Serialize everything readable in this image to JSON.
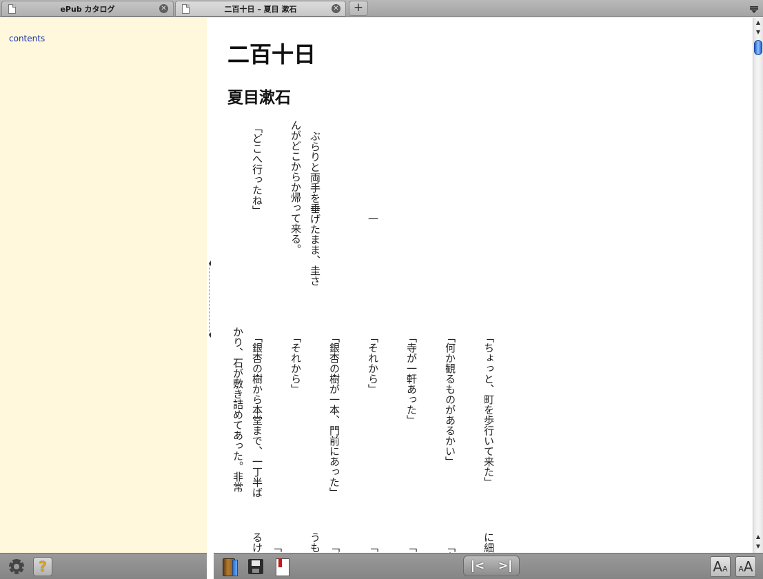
{
  "tabs": [
    {
      "label": "ePub カタログ",
      "active": false
    },
    {
      "label": "二百十日 – 夏目 漱石",
      "active": true
    }
  ],
  "tabbar": {
    "new_tab_label": "+"
  },
  "sidebar": {
    "contents_link": "contents"
  },
  "book": {
    "title": "二百十日",
    "author": "夏目漱石",
    "sections": [
      {
        "columns": [
          "一",
          "ぶらりと両手を垂げたまま、圭さ",
          "んがどこからか帰って来る。",
          "「どこへ行ったね」"
        ]
      },
      {
        "columns": [
          "「ちょっと、町を歩行いて来た」",
          "「何か観るものがあるかい」",
          "「寺が一軒あった」",
          "「それから」",
          "「銀杏の樹が一本、門前にあった」",
          "「それから」",
          "「銀杏の樹から本堂まで、一丁半ば",
          "かり、石が敷き詰めてあった。非常"
        ]
      },
      {
        "columns": [
          "に細",
          "「言",
          "「や",
          "「そ",
          "「別",
          "うも",
          "「そ",
          "るけ"
        ]
      }
    ]
  },
  "toolbar": {
    "prev_label": "|<",
    "next_label": ">|",
    "help_label": "?",
    "font_small_label": "A",
    "font_large_label": "A"
  },
  "colors": {
    "sidebar_bg": "#fff8dc",
    "link": "#1a2ea8",
    "toolbar_bg": "#8f8f8f",
    "scroll_thumb": "#3b82f6"
  }
}
